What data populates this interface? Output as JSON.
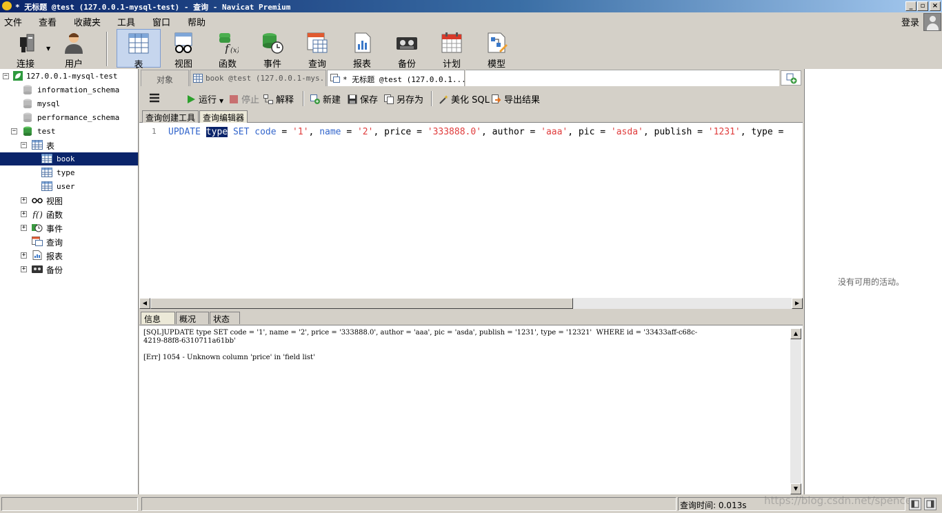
{
  "window": {
    "title": "* 无标题 @test (127.0.0.1-mysql-test) - 查询 - Navicat Premium"
  },
  "menu": [
    "文件",
    "查看",
    "收藏夹",
    "工具",
    "窗口",
    "帮助"
  ],
  "login": "登录",
  "toolbar": [
    {
      "label": "连接",
      "icon": "connection-plug-icon"
    },
    {
      "label": "用户",
      "icon": "user-icon"
    },
    {
      "label": "表",
      "icon": "table-icon",
      "active": true
    },
    {
      "label": "视图",
      "icon": "view-glasses-icon"
    },
    {
      "label": "函数",
      "icon": "function-fx-icon"
    },
    {
      "label": "事件",
      "icon": "event-clock-icon"
    },
    {
      "label": "查询",
      "icon": "query-icon"
    },
    {
      "label": "报表",
      "icon": "report-icon"
    },
    {
      "label": "备份",
      "icon": "backup-tape-icon"
    },
    {
      "label": "计划",
      "icon": "schedule-calendar-icon"
    },
    {
      "label": "模型",
      "icon": "model-icon"
    }
  ],
  "tree": {
    "connection": "127.0.0.1-mysql-test",
    "schemas": [
      "information_schema",
      "mysql",
      "performance_schema"
    ],
    "db": "test",
    "tables_label": "表",
    "tables": [
      "book",
      "type",
      "user"
    ],
    "selected_table": "book",
    "groups": [
      "视图",
      "函数",
      "事件",
      "查询",
      "报表",
      "备份"
    ]
  },
  "tabs": [
    "对象",
    "book @test (127.0.0.1-mys...",
    "* 无标题 @test (127.0.0.1..."
  ],
  "query_toolbar": {
    "run": "运行",
    "stop": "停止",
    "explain": "解释",
    "new": "新建",
    "save": "保存",
    "save_as": "另存为",
    "beautify": "美化 SQL",
    "export": "导出结果"
  },
  "editor_tabs": [
    "查询创建工具",
    "查询编辑器"
  ],
  "editor": {
    "line_number": "1",
    "code": [
      {
        "t": "UPDATE",
        "c": "kw"
      },
      {
        "t": " "
      },
      {
        "t": "type",
        "c": "hl"
      },
      {
        "t": " "
      },
      {
        "t": "SET",
        "c": "kw"
      },
      {
        "t": " "
      },
      {
        "t": "code",
        "c": "kw"
      },
      {
        "t": " = "
      },
      {
        "t": "'1'",
        "c": "str"
      },
      {
        "t": ", "
      },
      {
        "t": "name",
        "c": "kw"
      },
      {
        "t": " = "
      },
      {
        "t": "'2'",
        "c": "str"
      },
      {
        "t": ", price = "
      },
      {
        "t": "'333888.0'",
        "c": "str"
      },
      {
        "t": ", author = "
      },
      {
        "t": "'aaa'",
        "c": "str"
      },
      {
        "t": ", pic = "
      },
      {
        "t": "'asda'",
        "c": "str"
      },
      {
        "t": ", publish = "
      },
      {
        "t": "'1231'",
        "c": "str"
      },
      {
        "t": ", type ="
      }
    ]
  },
  "result_tabs": [
    "信息",
    "概况",
    "状态"
  ],
  "messages": [
    "[SQL]UPDATE type SET code = '1', name = '2', price = '333888.0', author = 'aaa', pic = 'asda', publish = '1231', type = '12321'  WHERE id = '33433aff-c68c-",
    "4219-88f8-6310711a61bb'",
    "[Err] 1054 - Unknown column 'price' in 'field list'"
  ],
  "activity": "没有可用的活动。",
  "status": {
    "query_time": "查询时间: 0.013s"
  },
  "watermark": "https://blog.csdn.net/spencer_"
}
